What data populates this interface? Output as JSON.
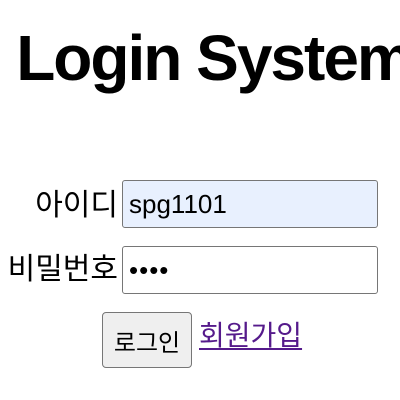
{
  "header": {
    "title": "Login System"
  },
  "form": {
    "id_label": "아이디",
    "id_value": "spg1101",
    "password_label": "비밀번호",
    "password_value": "••••",
    "login_button": "로그인",
    "signup_link": "회원가입"
  },
  "colors": {
    "autofill_background": "#e8f0fe",
    "visited_link": "#551a8b",
    "button_background": "#efefef",
    "border": "#767676"
  }
}
